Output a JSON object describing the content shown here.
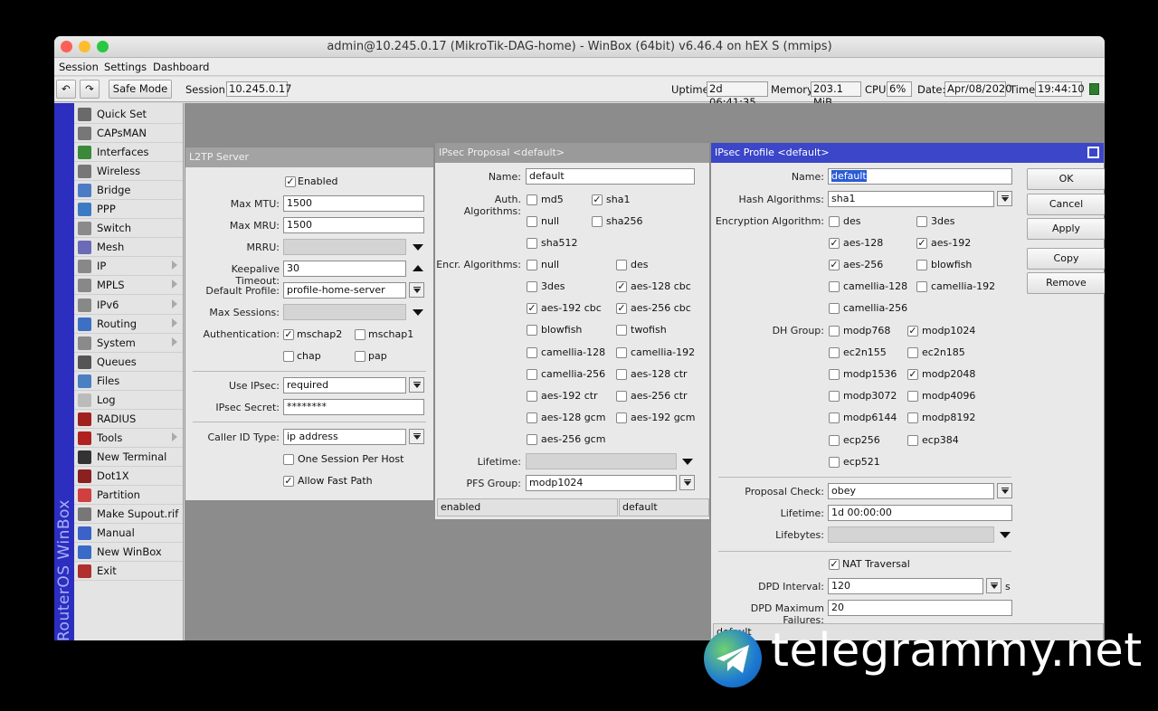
{
  "window": {
    "title": "admin@10.245.0.17 (MikroTik-DAG-home) - WinBox (64bit) v6.46.4 on hEX S (mmips)"
  },
  "menu": [
    "Session",
    "Settings",
    "Dashboard"
  ],
  "toolbar": {
    "safe_mode": "Safe Mode",
    "session_label": "Session:",
    "session_value": "10.245.0.17",
    "uptime_label": "Uptime:",
    "uptime_value": "2d 06:41:35",
    "memory_label": "Memory:",
    "memory_value": "203.1 MiB",
    "cpu_label": "CPU:",
    "cpu_value": "6%",
    "date_label": "Date:",
    "date_value": "Apr/08/2020",
    "time_label": "Time:",
    "time_value": "19:44:10"
  },
  "sidebar": {
    "vertical_label": "RouterOS WinBox",
    "items": [
      {
        "label": "Quick Set",
        "icon": "wand-icon",
        "color": "#6a6a6a",
        "submenu": false
      },
      {
        "label": "CAPsMAN",
        "icon": "antenna-icon",
        "color": "#777777",
        "submenu": false
      },
      {
        "label": "Interfaces",
        "icon": "interfaces-icon",
        "color": "#3a8a3a",
        "submenu": false
      },
      {
        "label": "Wireless",
        "icon": "wireless-icon",
        "color": "#777777",
        "submenu": false
      },
      {
        "label": "Bridge",
        "icon": "bridge-icon",
        "color": "#4d7cc7",
        "submenu": false
      },
      {
        "label": "PPP",
        "icon": "ppp-icon",
        "color": "#3d7ac4",
        "submenu": false
      },
      {
        "label": "Switch",
        "icon": "switch-icon",
        "color": "#8a8a8a",
        "submenu": false
      },
      {
        "label": "Mesh",
        "icon": "mesh-icon",
        "color": "#6b6bb8",
        "submenu": false
      },
      {
        "label": "IP",
        "icon": "ip-icon",
        "color": "#888888",
        "submenu": true
      },
      {
        "label": "MPLS",
        "icon": "mpls-icon",
        "color": "#888888",
        "submenu": true
      },
      {
        "label": "IPv6",
        "icon": "ipv6-icon",
        "color": "#888888",
        "submenu": true
      },
      {
        "label": "Routing",
        "icon": "routing-icon",
        "color": "#3d6fc4",
        "submenu": true
      },
      {
        "label": "System",
        "icon": "gear-icon",
        "color": "#8a8a8a",
        "submenu": true
      },
      {
        "label": "Queues",
        "icon": "queues-icon",
        "color": "#555555",
        "submenu": false
      },
      {
        "label": "Files",
        "icon": "folder-icon",
        "color": "#4a7fc4",
        "submenu": false
      },
      {
        "label": "Log",
        "icon": "log-icon",
        "color": "#bbbbbb",
        "submenu": false
      },
      {
        "label": "RADIUS",
        "icon": "radius-icon",
        "color": "#a02020",
        "submenu": false
      },
      {
        "label": "Tools",
        "icon": "tools-icon",
        "color": "#b02222",
        "submenu": true
      },
      {
        "label": "New Terminal",
        "icon": "terminal-icon",
        "color": "#333333",
        "submenu": false
      },
      {
        "label": "Dot1X",
        "icon": "dot1x-icon",
        "color": "#8a2020",
        "submenu": false
      },
      {
        "label": "Partition",
        "icon": "partition-icon",
        "color": "#d04040",
        "submenu": false
      },
      {
        "label": "Make Supout.rif",
        "icon": "supout-icon",
        "color": "#777777",
        "submenu": false
      },
      {
        "label": "Manual",
        "icon": "help-icon",
        "color": "#3a62c8",
        "submenu": false
      },
      {
        "label": "New WinBox",
        "icon": "winbox-icon",
        "color": "#3a6ac8",
        "submenu": false
      },
      {
        "label": "Exit",
        "icon": "exit-icon",
        "color": "#b03030",
        "submenu": false
      }
    ]
  },
  "l2tp": {
    "title": "L2TP Server",
    "enabled": "Enabled",
    "max_mtu_label": "Max MTU:",
    "max_mtu": "1500",
    "max_mru_label": "Max MRU:",
    "max_mru": "1500",
    "mrru_label": "MRRU:",
    "keepalive_label": "Keepalive Timeout:",
    "keepalive": "30",
    "default_profile_label": "Default Profile:",
    "default_profile": "profile-home-server",
    "max_sessions_label": "Max Sessions:",
    "auth_label": "Authentication:",
    "auth_mschap2": "mschap2",
    "auth_mschap1": "mschap1",
    "auth_chap": "chap",
    "auth_pap": "pap",
    "use_ipsec_label": "Use IPsec:",
    "use_ipsec": "required",
    "ipsec_secret_label": "IPsec Secret:",
    "ipsec_secret": "********",
    "caller_id_label": "Caller ID Type:",
    "caller_id": "ip address",
    "one_session": "One Session Per Host",
    "allow_fast_path": "Allow Fast Path"
  },
  "proposal": {
    "title": "IPsec Proposal <default>",
    "name_label": "Name:",
    "name": "default",
    "auth_label": "Auth. Algorithms:",
    "auth": {
      "md5": "md5",
      "sha1": "sha1",
      "null": "null",
      "sha256": "sha256",
      "sha512": "sha512"
    },
    "encr_label": "Encr. Algorithms:",
    "encr": {
      "null": "null",
      "des": "des",
      "3des": "3des",
      "aes128cbc": "aes-128 cbc",
      "aes192cbc": "aes-192 cbc",
      "aes256cbc": "aes-256 cbc",
      "blowfish": "blowfish",
      "twofish": "twofish",
      "camellia128": "camellia-128",
      "camellia192": "camellia-192",
      "camellia256": "camellia-256",
      "aes128ctr": "aes-128 ctr",
      "aes192ctr": "aes-192 ctr",
      "aes256ctr": "aes-256 ctr",
      "aes128gcm": "aes-128 gcm",
      "aes192gcm": "aes-192 gcm",
      "aes256gcm": "aes-256 gcm"
    },
    "lifetime_label": "Lifetime:",
    "pfs_label": "PFS Group:",
    "pfs": "modp1024",
    "status_left": "enabled",
    "status_right": "default"
  },
  "profile": {
    "title": "IPsec Profile <default>",
    "name_label": "Name:",
    "name": "default",
    "hash_label": "Hash Algorithms:",
    "hash": "sha1",
    "enc_label": "Encryption Algorithm:",
    "enc": {
      "des": "des",
      "3des": "3des",
      "aes128": "aes-128",
      "aes192": "aes-192",
      "aes256": "aes-256",
      "blowfish": "blowfish",
      "camellia128": "camellia-128",
      "camellia192": "camellia-192",
      "camellia256": "camellia-256"
    },
    "dh_label": "DH Group:",
    "dh": {
      "modp768": "modp768",
      "modp1024": "modp1024",
      "ec2n155": "ec2n155",
      "ec2n185": "ec2n185",
      "modp1536": "modp1536",
      "modp2048": "modp2048",
      "modp3072": "modp3072",
      "modp4096": "modp4096",
      "modp6144": "modp6144",
      "modp8192": "modp8192",
      "ecp256": "ecp256",
      "ecp384": "ecp384",
      "ecp521": "ecp521"
    },
    "proposal_check_label": "Proposal Check:",
    "proposal_check": "obey",
    "lifetime_label": "Lifetime:",
    "lifetime": "1d 00:00:00",
    "lifebytes_label": "Lifebytes:",
    "nat_traversal": "NAT Traversal",
    "dpd_interval_label": "DPD Interval:",
    "dpd_interval": "120",
    "dpd_unit": "s",
    "dpd_failures_label": "DPD Maximum Failures:",
    "dpd_failures": "20",
    "status": "default",
    "buttons": {
      "ok": "OK",
      "cancel": "Cancel",
      "apply": "Apply",
      "copy": "Copy",
      "remove": "Remove"
    }
  },
  "watermark": "telegrammy.net"
}
